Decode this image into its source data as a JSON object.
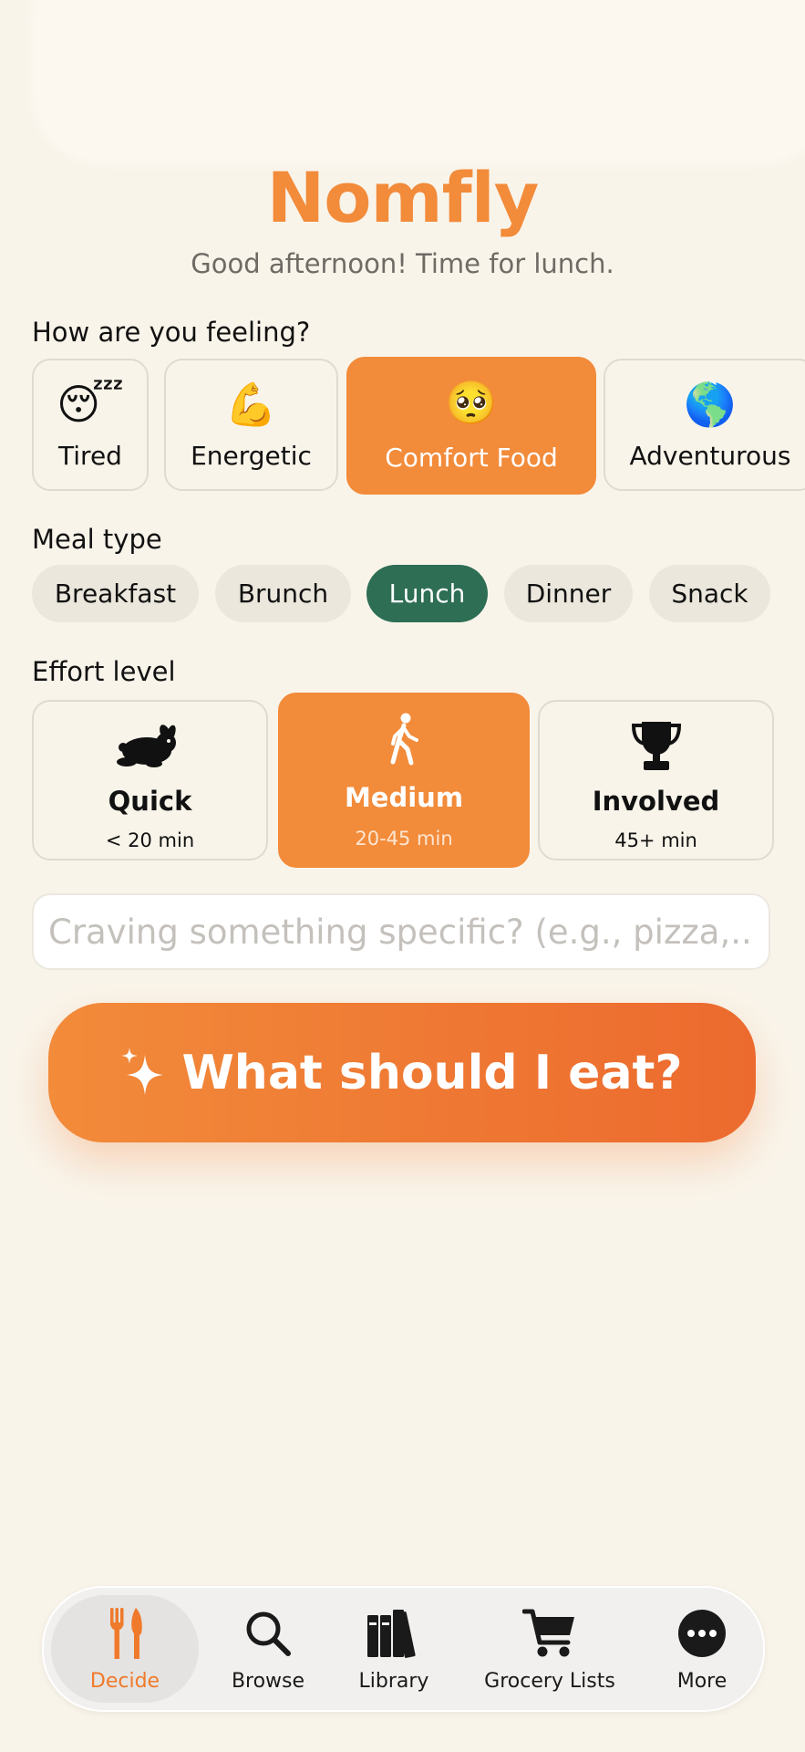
{
  "app": {
    "title": "Nomfly",
    "greeting": "Good afternoon! Time for lunch."
  },
  "mood": {
    "label": "How are you feeling?",
    "selected": "Comfort Food",
    "options": [
      {
        "emoji": "😴",
        "label": "Tired"
      },
      {
        "emoji": "💪",
        "label": "Energetic"
      },
      {
        "emoji": "🥺",
        "label": "Comfort Food"
      },
      {
        "emoji": "🌎",
        "label": "Adventurous"
      }
    ]
  },
  "meal": {
    "label": "Meal type",
    "selected": "Lunch",
    "options": [
      "Breakfast",
      "Brunch",
      "Lunch",
      "Dinner",
      "Snack"
    ]
  },
  "effort": {
    "label": "Effort level",
    "selected": "Medium",
    "options": [
      {
        "icon": "rabbit-icon",
        "title": "Quick",
        "subtitle": "< 20 min"
      },
      {
        "icon": "walking-person-icon",
        "title": "Medium",
        "subtitle": "20-45 min"
      },
      {
        "icon": "trophy-icon",
        "title": "Involved",
        "subtitle": "45+ min"
      }
    ]
  },
  "craving": {
    "value": "",
    "placeholder": "Craving something specific? (e.g., pizza,..."
  },
  "cta": {
    "icon": "sparkles-icon",
    "label": "What should I eat?"
  },
  "tabs": {
    "active": "Decide",
    "items": [
      {
        "icon": "fork-knife-icon",
        "label": "Decide"
      },
      {
        "icon": "search-icon",
        "label": "Browse"
      },
      {
        "icon": "books-icon",
        "label": "Library"
      },
      {
        "icon": "cart-icon",
        "label": "Grocery Lists"
      },
      {
        "icon": "more-icon",
        "label": "More"
      }
    ]
  },
  "colors": {
    "accent": "#f28b3a",
    "selected_meal": "#2e6e55",
    "background": "#f9f4ea",
    "active_tab_label": "#f07a2c"
  }
}
